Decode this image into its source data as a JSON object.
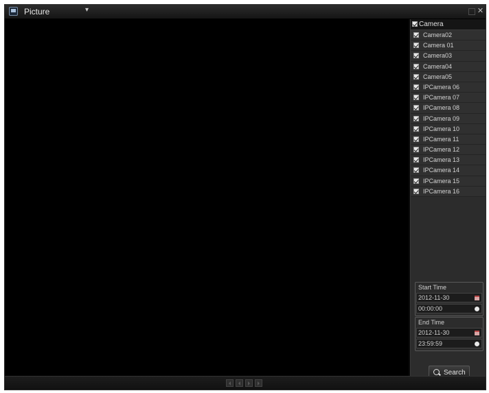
{
  "window": {
    "title": "Picture",
    "dropdown_glyph": "▾",
    "close_glyph": "✕",
    "icon": "picture-app-icon"
  },
  "camera_panel": {
    "header_label": "Camera",
    "cameras": [
      "Camera02",
      "Camera 01",
      "Camera03",
      "Camera04",
      "Camera05",
      "IPCamera 06",
      "IPCamera 07",
      "IPCamera 08",
      "IPCamera 09",
      "IPCamera 10",
      "IPCamera 11",
      "IPCamera 12",
      "IPCamera 13",
      "IPCamera 14",
      "IPCamera 15",
      "IPCamera 16"
    ]
  },
  "start_time": {
    "label": "Start Time",
    "date": "2012-11-30",
    "time": "00:00:00"
  },
  "end_time": {
    "label": "End Time",
    "date": "2012-11-30",
    "time": "23:59:59"
  },
  "search": {
    "label": "Search",
    "icon": "search-icon"
  },
  "colors": {
    "background": "#000000",
    "panel": "#2c2c2c",
    "text": "#d2d2d2"
  }
}
